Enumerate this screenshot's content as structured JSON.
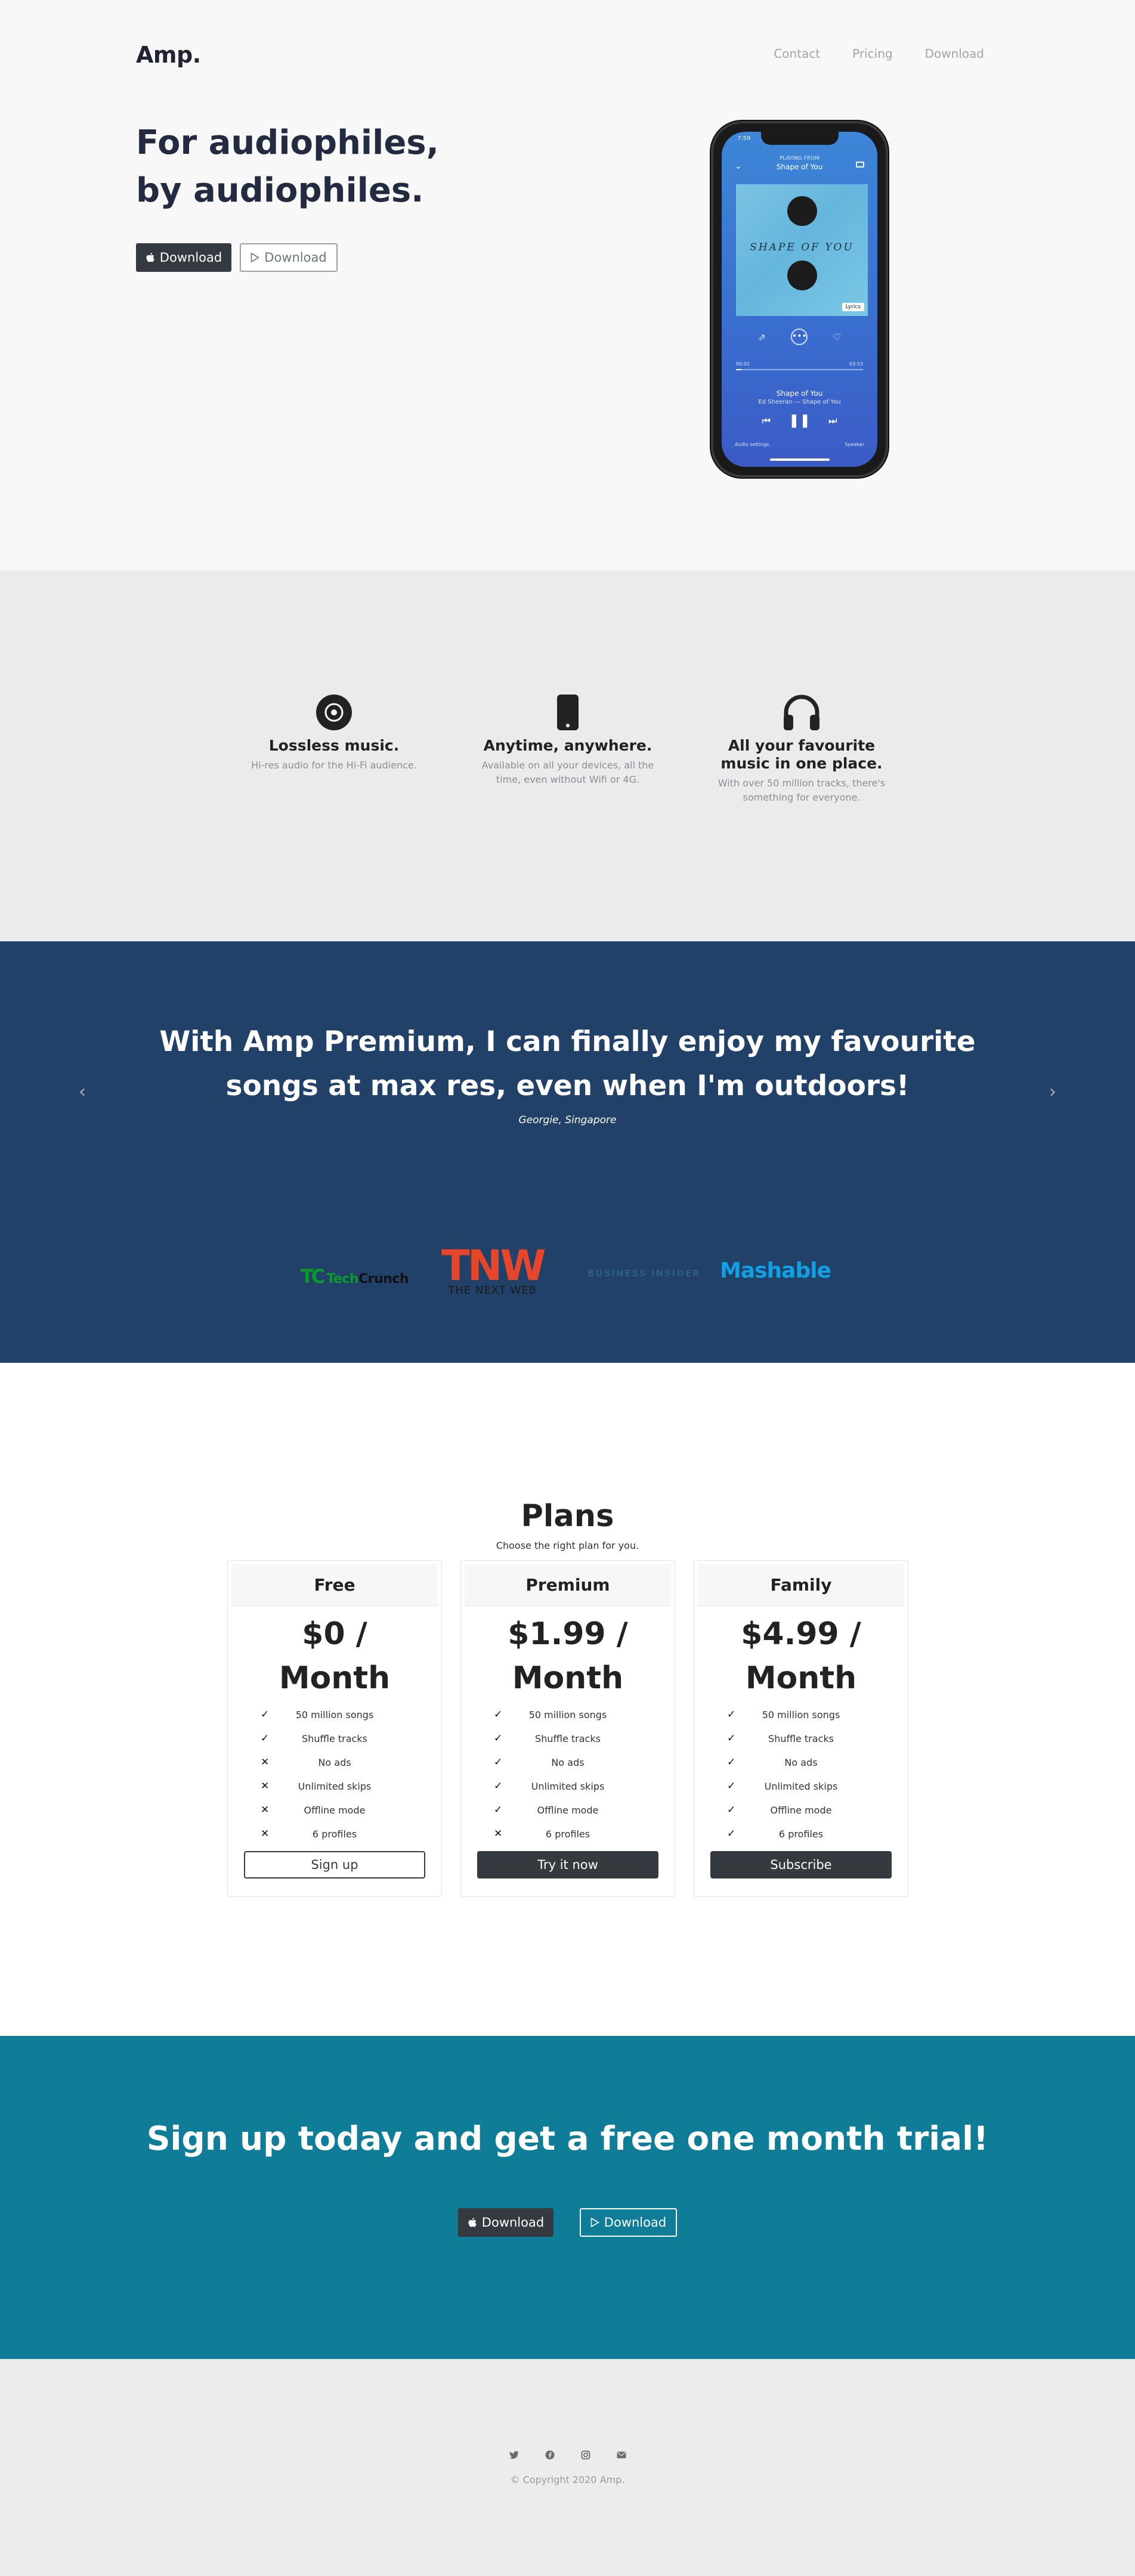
{
  "brand": {
    "logo": "Amp."
  },
  "nav": {
    "items": [
      "Contact",
      "Pricing",
      "Download"
    ]
  },
  "hero": {
    "title_line1": "For audiophiles,",
    "title_line2": "by audiophiles.",
    "btn_apple": "Download",
    "btn_play": "Download"
  },
  "phone": {
    "time": "7:59",
    "now_playing_small": "PLAYING FROM",
    "now_playing_title": "Shape of You",
    "album_text": "SHAPE OF YOU",
    "lyrics_label": "Lyrics",
    "time_elapsed": "00:02",
    "time_total": "03:53",
    "progress": 0.04,
    "song": "Shape of You",
    "artist": "Ed Sheeran — Shape of You",
    "audio_settings": "Audio settings",
    "speaker": "Speaker"
  },
  "features": [
    {
      "title": "Lossless music.",
      "desc": "Hi-res audio for the Hi-Fi audience.",
      "icon": "disc-icon"
    },
    {
      "title": "Anytime, anywhere.",
      "desc": "Available on all your devices, all the time, even without Wifi or 4G.",
      "icon": "mobile-icon"
    },
    {
      "title": "All your favourite music in one place.",
      "desc": "With over 50 million tracks, there's something for everyone.",
      "icon": "headphones-icon"
    }
  ],
  "testimonial": {
    "quote": "With Amp Premium, I can finally enjoy my favourite songs at max res, even when I'm outdoors!",
    "author": "Georgie, Singapore"
  },
  "press": {
    "techcrunch_a": "Tech",
    "techcrunch_b": "Crunch",
    "tnw_big": "TNW",
    "tnw_small": "THE NEXT WEB",
    "business_insider": "BUSINESS INSIDER",
    "mashable": "Mashable"
  },
  "plans": {
    "title": "Plans",
    "subtitle": "Choose the right plan for you.",
    "cards": [
      {
        "name": "Free",
        "price_line1": "$0 /",
        "price_line2": "Month",
        "button": "Sign up",
        "button_style": "outline",
        "features": [
          {
            "label": "50 million songs",
            "included": true
          },
          {
            "label": "Shuffle tracks",
            "included": true
          },
          {
            "label": "No ads",
            "included": false
          },
          {
            "label": "Unlimited skips",
            "included": false
          },
          {
            "label": "Offline mode",
            "included": false
          },
          {
            "label": "6 profiles",
            "included": false
          }
        ]
      },
      {
        "name": "Premium",
        "price_line1": "$1.99 /",
        "price_line2": "Month",
        "button": "Try it now",
        "button_style": "solid",
        "features": [
          {
            "label": "50 million songs",
            "included": true
          },
          {
            "label": "Shuffle tracks",
            "included": true
          },
          {
            "label": "No ads",
            "included": true
          },
          {
            "label": "Unlimited skips",
            "included": true
          },
          {
            "label": "Offline mode",
            "included": true
          },
          {
            "label": "6 profiles",
            "included": false
          }
        ]
      },
      {
        "name": "Family",
        "price_line1": "$4.99 /",
        "price_line2": "Month",
        "button": "Subscribe",
        "button_style": "solid",
        "features": [
          {
            "label": "50 million songs",
            "included": true
          },
          {
            "label": "Shuffle tracks",
            "included": true
          },
          {
            "label": "No ads",
            "included": true
          },
          {
            "label": "Unlimited skips",
            "included": true
          },
          {
            "label": "Offline mode",
            "included": true
          },
          {
            "label": "6 profiles",
            "included": true
          }
        ]
      }
    ]
  },
  "cta": {
    "title": "Sign up today and get a free one month trial!",
    "btn_apple": "Download",
    "btn_play": "Download"
  },
  "footer": {
    "socials": [
      "twitter-icon",
      "facebook-icon",
      "instagram-icon",
      "envelope-icon"
    ],
    "copyright": "© Copyright 2020 Amp."
  },
  "colors": {
    "hero_bg": "#f8f8f8",
    "features_bg": "#ebebeb",
    "testimonial_bg": "#214168",
    "cta_bg": "#0f7c98",
    "footer_bg": "#ececec",
    "dark_button": "#343a40"
  }
}
